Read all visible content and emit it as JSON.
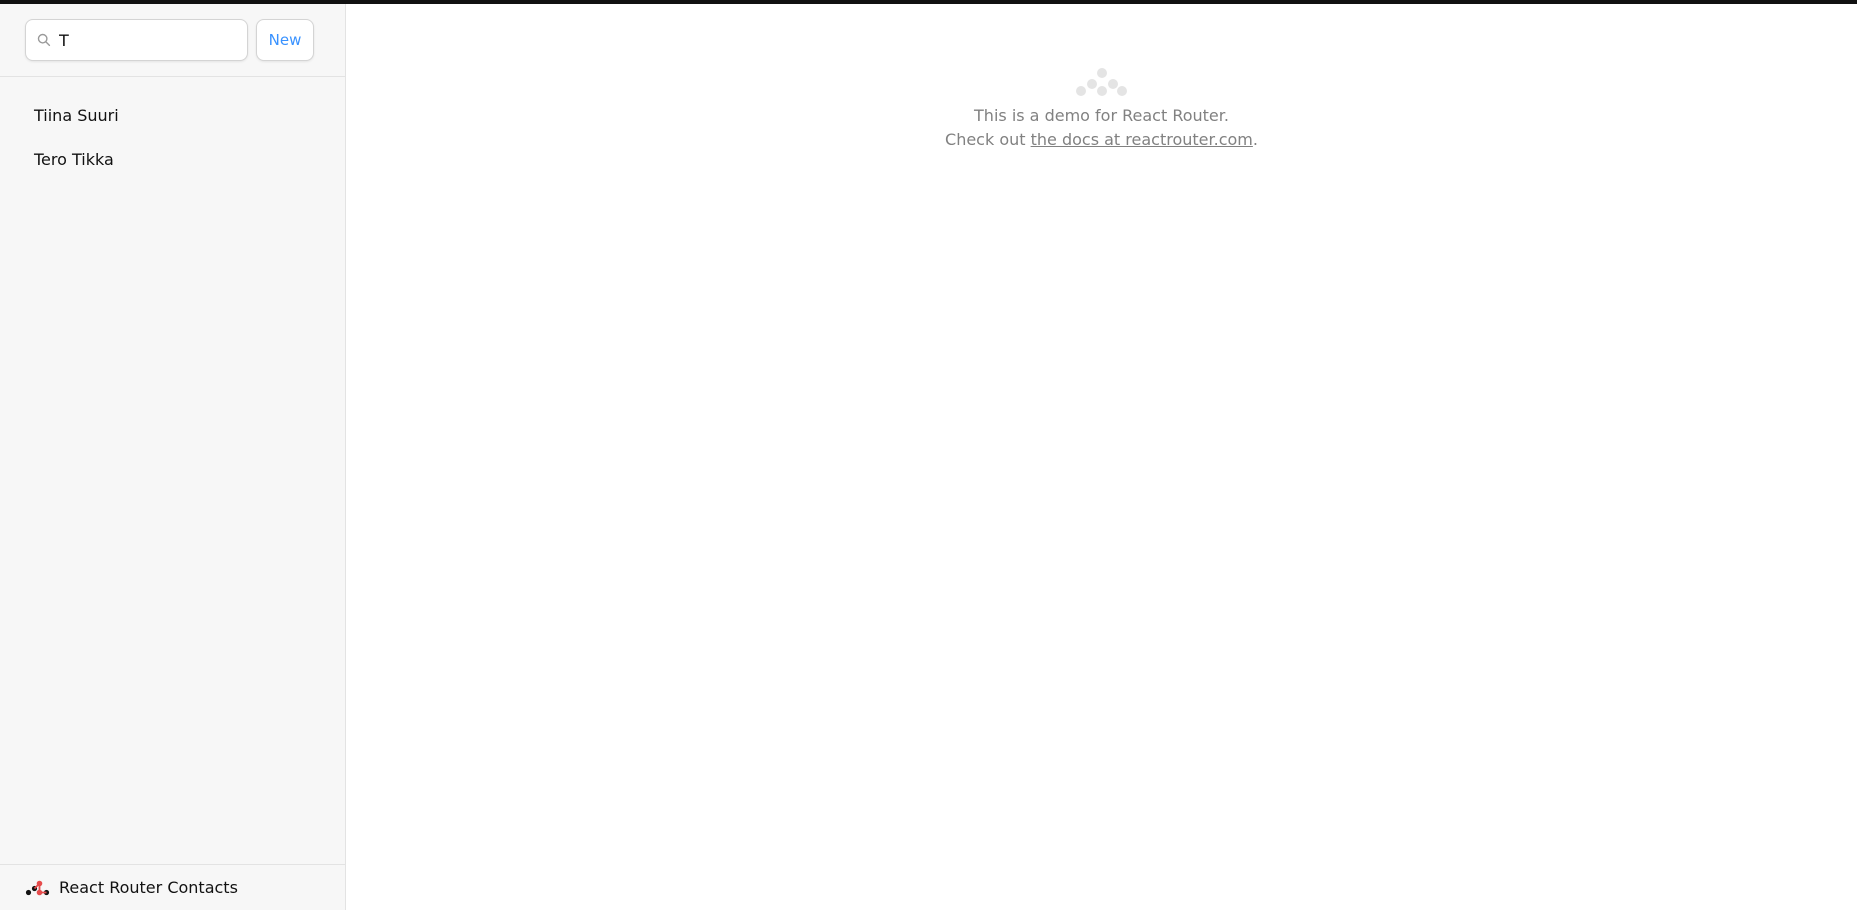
{
  "search": {
    "value": "T",
    "placeholder": "Search"
  },
  "toolbar": {
    "new_label": "New"
  },
  "contacts": [
    {
      "name": "Tiina Suuri"
    },
    {
      "name": "Tero Tikka"
    }
  ],
  "footer": {
    "title": "React Router Contacts"
  },
  "index": {
    "line1": "This is a demo for React Router.",
    "line2_prefix": "Check out ",
    "link_text": "the docs at reactrouter.com",
    "line2_suffix": "."
  },
  "colors": {
    "accent": "#3992ff",
    "logo_red": "#e64c4c",
    "sidebar_bg": "#f7f7f7",
    "muted_text": "#818181"
  },
  "icons": {
    "search": "search-icon",
    "footer_logo": "react-router-logo-icon",
    "index_logo": "react-router-logo-icon"
  }
}
